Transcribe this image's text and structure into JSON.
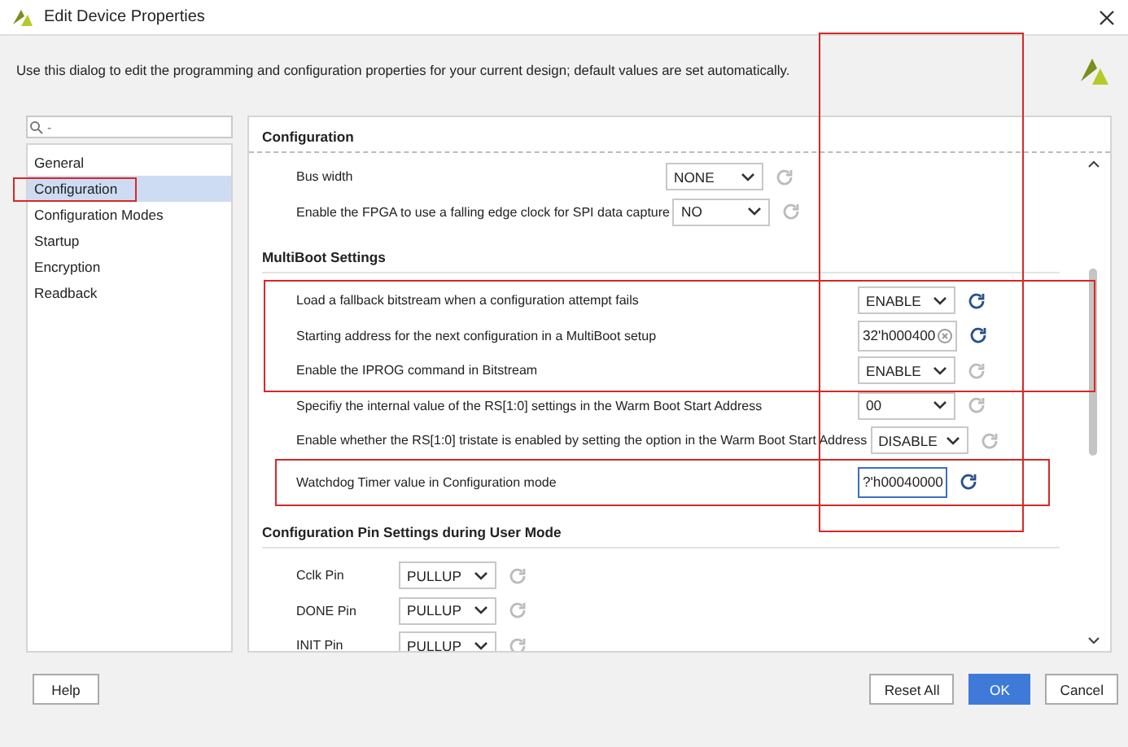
{
  "window": {
    "title": "Edit Device Properties"
  },
  "description": "Use this dialog to edit the programming and configuration properties for your current design; default values are set automatically.",
  "sidebar": {
    "search": {
      "placeholder": "-"
    },
    "items": [
      {
        "label": "General",
        "selected": false,
        "highlighted": false
      },
      {
        "label": "Configuration",
        "selected": true,
        "highlighted": true
      },
      {
        "label": "Configuration Modes",
        "selected": false,
        "highlighted": false
      },
      {
        "label": "Startup",
        "selected": false,
        "highlighted": false
      },
      {
        "label": "Encryption",
        "selected": false,
        "highlighted": false
      },
      {
        "label": "Readback",
        "selected": false,
        "highlighted": false
      }
    ]
  },
  "panel": {
    "title": "Configuration",
    "value_column_highlighted": true,
    "sections": [
      {
        "rows": [
          {
            "label": "Bus width",
            "kind": "dropdown",
            "value": "NONE",
            "reset_enabled": false,
            "highlighted": false
          },
          {
            "label": "Enable the FPGA to use a falling edge clock for SPI data capture",
            "kind": "dropdown",
            "value": "NO",
            "reset_enabled": false,
            "highlighted": false
          }
        ]
      },
      {
        "heading": "MultiBoot Settings",
        "rows": [
          {
            "label": "Load a fallback bitstream when a configuration attempt fails",
            "kind": "dropdown",
            "value": "ENABLE",
            "reset_enabled": true,
            "highlighted": true
          },
          {
            "label": "Starting address for the next configuration in a MultiBoot setup",
            "kind": "text",
            "value": "32'h000400",
            "clearable": true,
            "focused": false,
            "reset_enabled": true,
            "highlighted": true
          },
          {
            "label": "Enable the IPROG command in Bitstream",
            "kind": "dropdown",
            "value": "ENABLE",
            "reset_enabled": false,
            "highlighted": true
          },
          {
            "label": "Specifiy the internal value of the RS[1:0] settings in the Warm Boot Start Address",
            "kind": "dropdown",
            "value": "00",
            "reset_enabled": false,
            "highlighted": false
          },
          {
            "label": "Enable whether the RS[1:0] tristate is enabled by setting the option in the Warm Boot Start Address",
            "kind": "dropdown",
            "value": "DISABLE",
            "reset_enabled": false,
            "highlighted": false
          },
          {
            "label": "Watchdog Timer value in Configuration mode",
            "kind": "text",
            "value": "?'h00040000",
            "clearable": false,
            "focused": true,
            "reset_enabled": true,
            "highlighted": true
          }
        ]
      },
      {
        "heading": "Configuration Pin Settings during User Mode",
        "rows": [
          {
            "label": "Cclk Pin",
            "kind": "dropdown",
            "value": "PULLUP",
            "reset_enabled": false,
            "highlighted": false
          },
          {
            "label": "DONE Pin",
            "kind": "dropdown",
            "value": "PULLUP",
            "reset_enabled": false,
            "highlighted": false
          },
          {
            "label": "INIT Pin",
            "kind": "dropdown",
            "value": "PULLUP",
            "reset_enabled": false,
            "highlighted": false
          }
        ]
      }
    ]
  },
  "buttons": [
    {
      "label": "Help",
      "kind": "plain"
    },
    {
      "label": "Reset All",
      "kind": "plain"
    },
    {
      "label": "OK",
      "kind": "primary"
    },
    {
      "label": "Cancel",
      "kind": "plain"
    }
  ]
}
